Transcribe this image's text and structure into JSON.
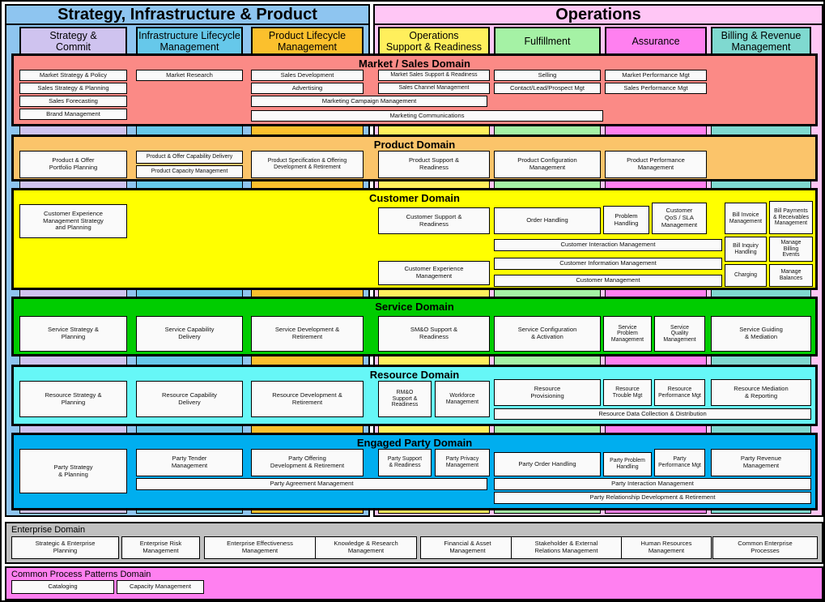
{
  "areas": [
    {
      "id": "sip",
      "title": "Strategy, Infrastructure & Product",
      "color": "#8ec5f0"
    },
    {
      "id": "ops",
      "title": "Operations",
      "color": "#ffc6f5"
    }
  ],
  "columns": [
    {
      "id": "sc",
      "label": "Strategy &\nCommit",
      "color": "#cfc3ef"
    },
    {
      "id": "ilm",
      "label": "Infrastructure Lifecycle\nManagement",
      "color": "#66c8ea"
    },
    {
      "id": "plm",
      "label": "Product Lifecycle\nManagement",
      "color": "#fbc02d"
    },
    {
      "id": "osr",
      "label": "Operations\nSupport & Readiness",
      "color": "#ffef5c"
    },
    {
      "id": "ful",
      "label": "Fulfillment",
      "color": "#a5f2a5"
    },
    {
      "id": "ass",
      "label": "Assurance",
      "color": "#ff80f0"
    },
    {
      "id": "brm",
      "label": "Billing & Revenue\nManagement",
      "color": "#7fd9d0"
    }
  ],
  "domains": [
    {
      "id": "market",
      "title": "Market / Sales Domain",
      "color": "#fb8a86",
      "boxes": [
        {
          "label": "Market Strategy & Policy"
        },
        {
          "label": "Sales Strategy & Planning"
        },
        {
          "label": "Sales Forecasting"
        },
        {
          "label": "Brand Management"
        },
        {
          "label": "Market Research"
        },
        {
          "label": "Sales Development"
        },
        {
          "label": "Advertising"
        },
        {
          "label": "Marketing Campaign Management"
        },
        {
          "label": "Marketing Communications"
        },
        {
          "label": "Market Sales Support & Readiness"
        },
        {
          "label": "Sales Channel Management"
        },
        {
          "label": "Selling"
        },
        {
          "label": "Contact/Lead/Prospect Mgt"
        },
        {
          "label": "Market Performance Mgt"
        },
        {
          "label": "Sales Performance Mgt"
        }
      ]
    },
    {
      "id": "product",
      "title": "Product Domain",
      "color": "#fbc46a",
      "boxes": [
        {
          "label": "Product & Offer\nPortfolio Planning"
        },
        {
          "label": "Product & Offer Capability Delivery"
        },
        {
          "label": "Product Capacity Management"
        },
        {
          "label": "Product Specification & Offering\nDevelopment & Retirement"
        },
        {
          "label": "Product Support &\nReadiness"
        },
        {
          "label": "Product Configuration\nManagement"
        },
        {
          "label": "Product Performance\nManagement"
        }
      ]
    },
    {
      "id": "customer",
      "title": "Customer Domain",
      "color": "#ffff00",
      "boxes": [
        {
          "label": "Customer Experience\nManagement Strategy\nand Planning"
        },
        {
          "label": "Customer Support &\nReadiness"
        },
        {
          "label": "Customer Experience\nManagement"
        },
        {
          "label": "Order Handling"
        },
        {
          "label": "Problem\nHandling"
        },
        {
          "label": "Customer\nQoS / SLA\nManagement"
        },
        {
          "label": "Customer Interaction Management"
        },
        {
          "label": "Customer Information Management"
        },
        {
          "label": "Customer Management"
        },
        {
          "label": "Bill Invoice\nManagement"
        },
        {
          "label": "Bill Payments\n& Receivables\nManagement"
        },
        {
          "label": "Bill Inquiry\nHandling"
        },
        {
          "label": "Manage\nBilling\nEvents"
        },
        {
          "label": "Charging"
        },
        {
          "label": "Manage\nBalances"
        }
      ]
    },
    {
      "id": "service",
      "title": "Service Domain",
      "color": "#00cc00",
      "boxes": [
        {
          "label": "Service Strategy &\nPlanning"
        },
        {
          "label": "Service Capability\nDelivery"
        },
        {
          "label": "Service Development &\nRetirement"
        },
        {
          "label": "SM&O Support &\nReadiness"
        },
        {
          "label": "Service Configuration\n& Activation"
        },
        {
          "label": "Service\nProblem\nManagement"
        },
        {
          "label": "Service\nQuality\nManagement"
        },
        {
          "label": "Service Guiding\n& Mediation"
        }
      ]
    },
    {
      "id": "resource",
      "title": "Resource Domain",
      "color": "#66f7f7",
      "boxes": [
        {
          "label": "Resource Strategy &\nPlanning"
        },
        {
          "label": "Resource Capability\nDelivery"
        },
        {
          "label": "Resource  Development &\nRetirement"
        },
        {
          "label": "RM&O\nSupport &\nReadiness"
        },
        {
          "label": "Workforce\nManagement"
        },
        {
          "label": "Resource\nProvisioning"
        },
        {
          "label": "Resource\nTrouble Mgt"
        },
        {
          "label": "Resource\nPerformance Mgt"
        },
        {
          "label": "Resource Mediation\n& Reporting"
        },
        {
          "label": "Resource Data Collection & Distribution"
        }
      ]
    },
    {
      "id": "party",
      "title": "Engaged Party Domain",
      "color": "#00aeef",
      "boxes": [
        {
          "label": "Party Strategy\n& Planning"
        },
        {
          "label": "Party Tender\nManagement"
        },
        {
          "label": "Party Offering\nDevelopment & Retirement"
        },
        {
          "label": "Party Agreement Management"
        },
        {
          "label": "Party Support\n& Readiness"
        },
        {
          "label": "Party Privacy\nManagement"
        },
        {
          "label": "Party Order Handling"
        },
        {
          "label": "Party Problem\nHandling"
        },
        {
          "label": "Party\nPerformance Mgt"
        },
        {
          "label": "Party Revenue\nManagement"
        },
        {
          "label": "Party Interaction Management"
        },
        {
          "label": "Party Relationship Development & Retirement"
        }
      ]
    }
  ],
  "enterprise": {
    "title": "Enterprise Domain",
    "color": "#c0c0c0",
    "boxes": [
      {
        "label": "Strategic & Enterprise\nPlanning"
      },
      {
        "label": "Enterprise Risk\nManagement"
      },
      {
        "label": "Enterprise Effectiveness\nManagement"
      },
      {
        "label": "Knowledge & Research\nManagement"
      },
      {
        "label": "Financial & Asset\nManagement"
      },
      {
        "label": "Stakeholder & External\nRelations Management"
      },
      {
        "label": "Human Resources\nManagement"
      },
      {
        "label": "Common Enterprise\nProcesses"
      }
    ]
  },
  "common": {
    "title": "Common Process Patterns Domain",
    "color": "#ff80f0",
    "boxes": [
      {
        "label": "Cataloging"
      },
      {
        "label": "Capacity Management"
      }
    ]
  }
}
